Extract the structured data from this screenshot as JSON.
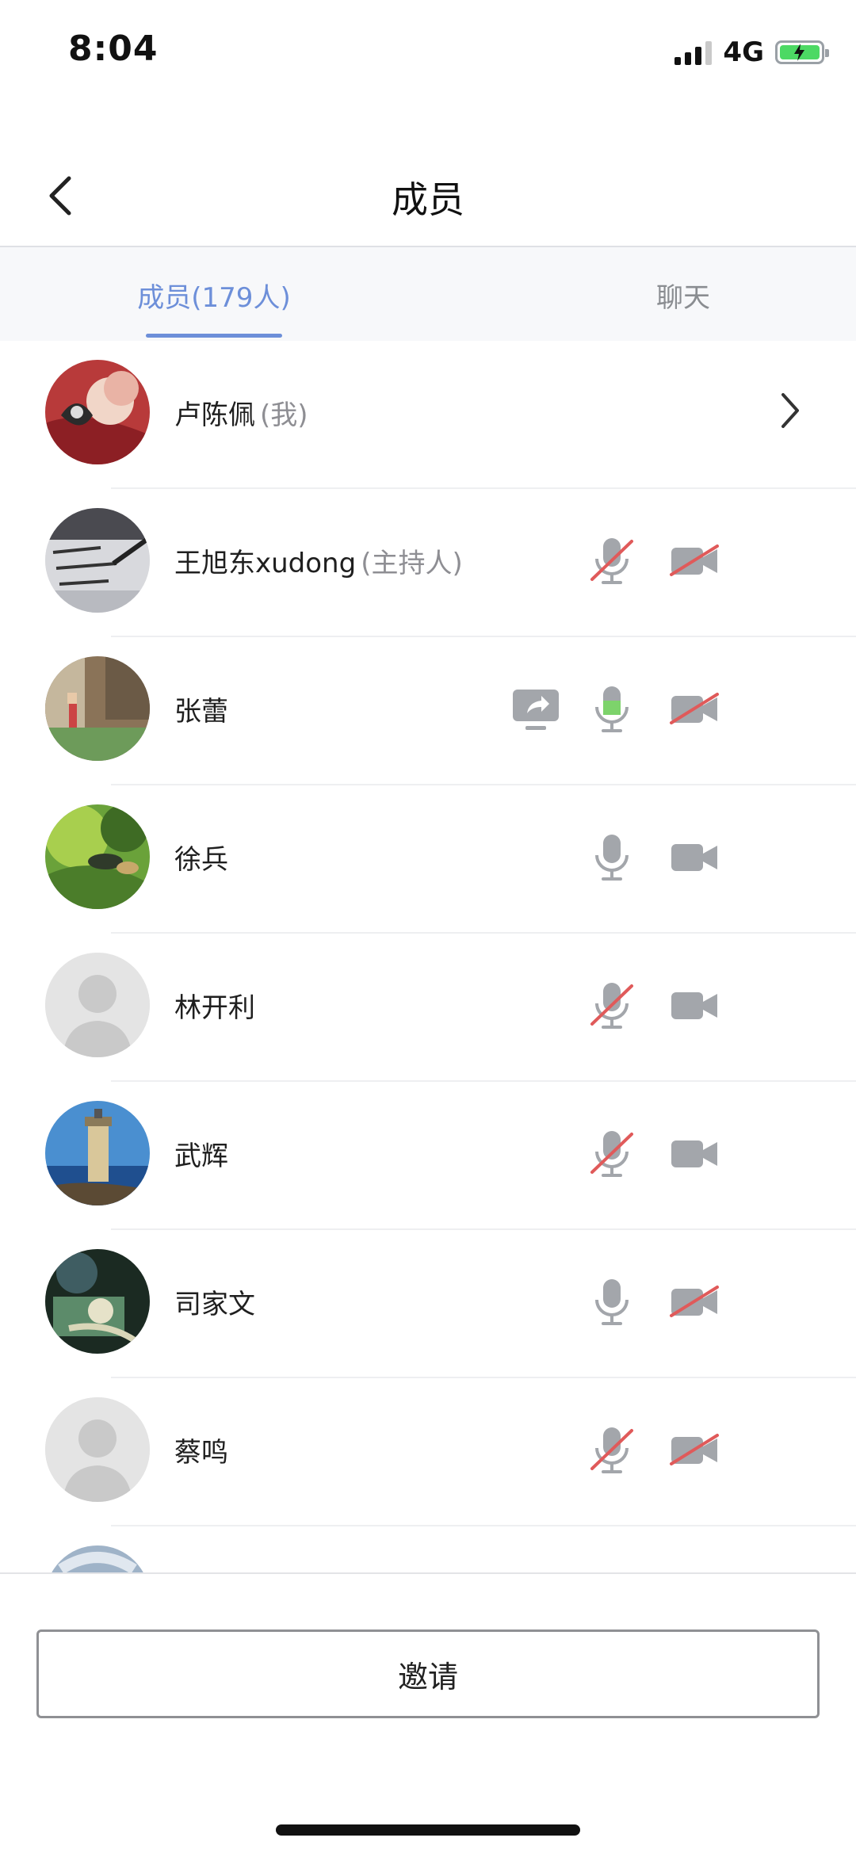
{
  "status_bar": {
    "time": "8:04",
    "network": "4G"
  },
  "nav": {
    "title": "成员"
  },
  "tabs": [
    {
      "label": "成员(179人)",
      "active": true
    },
    {
      "label": "聊天",
      "active": false
    }
  ],
  "members": [
    {
      "name": "卢陈佩",
      "role": "(我)",
      "avatar": "photo-red",
      "share": false,
      "mic": null,
      "cam": null,
      "chevron": true
    },
    {
      "name": "王旭东xudong",
      "role": "(主持人)",
      "avatar": "photo-paper",
      "share": false,
      "mic": "muted",
      "cam": "off",
      "chevron": false
    },
    {
      "name": "张蕾",
      "role": "",
      "avatar": "photo-street",
      "share": true,
      "mic": "speaking",
      "cam": "off",
      "chevron": false
    },
    {
      "name": "徐兵",
      "role": "",
      "avatar": "photo-green",
      "share": false,
      "mic": "on",
      "cam": "on",
      "chevron": false
    },
    {
      "name": "林开利",
      "role": "",
      "avatar": "default",
      "share": false,
      "mic": "muted",
      "cam": "on",
      "chevron": false
    },
    {
      "name": "武辉",
      "role": "",
      "avatar": "photo-lighthouse",
      "share": false,
      "mic": "muted",
      "cam": "on",
      "chevron": false
    },
    {
      "name": "司家文",
      "role": "",
      "avatar": "photo-surgery",
      "share": false,
      "mic": "on",
      "cam": "off",
      "chevron": false
    },
    {
      "name": "蔡鸣",
      "role": "",
      "avatar": "default",
      "share": false,
      "mic": "muted",
      "cam": "off",
      "chevron": false
    },
    {
      "name": "",
      "role": "",
      "avatar": "photo-partial",
      "share": false,
      "mic": null,
      "cam": null,
      "chevron": false
    }
  ],
  "invite_label": "邀请",
  "colors": {
    "accent": "#6d8fd9",
    "icon_gray": "#a3a6ab",
    "muted_slash": "#e05a5a",
    "speaking": "#7dd36b"
  }
}
